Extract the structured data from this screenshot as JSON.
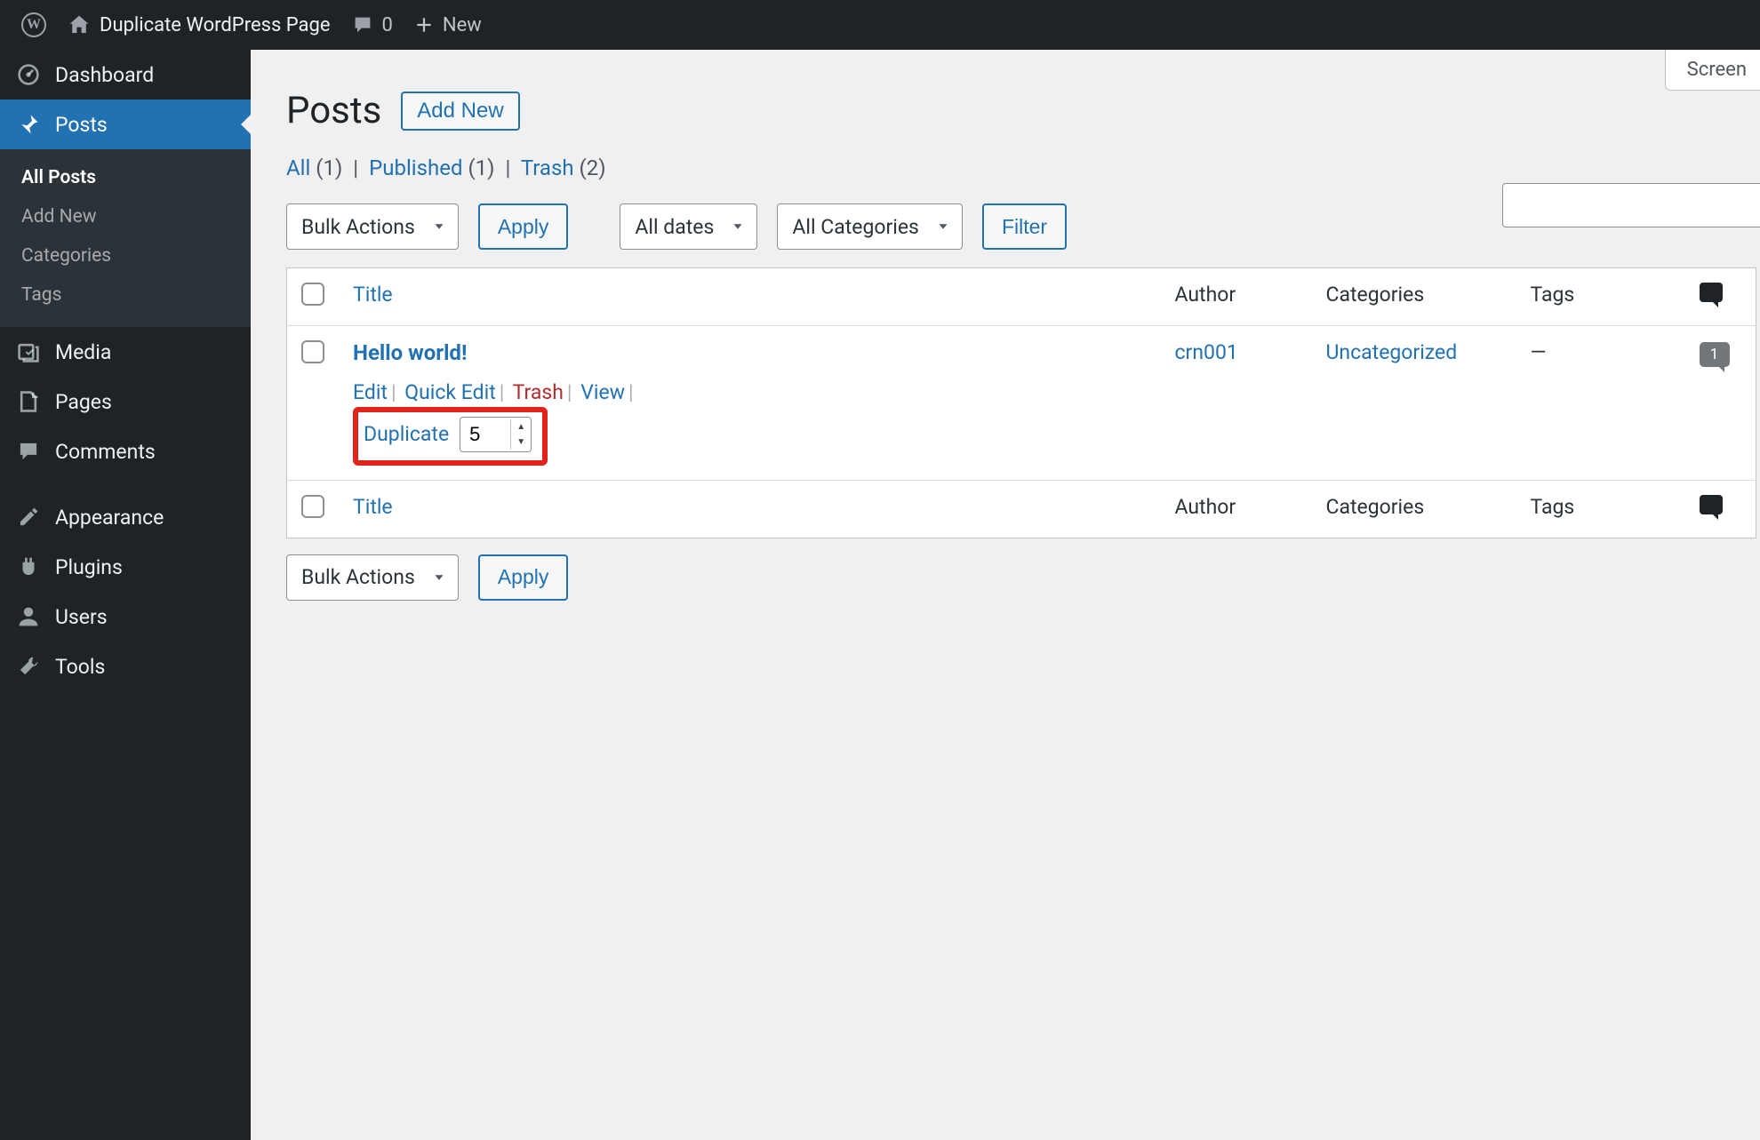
{
  "adminbar": {
    "site_name": "Duplicate WordPress Page",
    "comments_count": "0",
    "new_label": "New"
  },
  "sidebar": {
    "items": [
      {
        "icon": "dashboard-icon",
        "label": "Dashboard"
      },
      {
        "icon": "pin-icon",
        "label": "Posts",
        "current": true
      },
      {
        "icon": "media-icon",
        "label": "Media"
      },
      {
        "icon": "page-icon",
        "label": "Pages"
      },
      {
        "icon": "comment-icon",
        "label": "Comments"
      },
      {
        "icon": "appearance-icon",
        "label": "Appearance"
      },
      {
        "icon": "plugin-icon",
        "label": "Plugins"
      },
      {
        "icon": "user-icon",
        "label": "Users"
      },
      {
        "icon": "tools-icon",
        "label": "Tools"
      }
    ],
    "submenu": [
      {
        "label": "All Posts",
        "current": true
      },
      {
        "label": "Add New"
      },
      {
        "label": "Categories"
      },
      {
        "label": "Tags"
      }
    ]
  },
  "screen_options": "Screen",
  "page_title": "Posts",
  "add_new_btn": "Add New",
  "subsubsub": {
    "all_label": "All",
    "all_count": "(1)",
    "published_label": "Published",
    "published_count": "(1)",
    "trash_label": "Trash",
    "trash_count": "(2)"
  },
  "top_nav": {
    "bulk_actions": "Bulk Actions",
    "apply": "Apply",
    "all_dates": "All dates",
    "all_categories": "All Categories",
    "filter": "Filter"
  },
  "columns": {
    "title": "Title",
    "author": "Author",
    "categories": "Categories",
    "tags": "Tags"
  },
  "rows": [
    {
      "title": "Hello world!",
      "author": "crn001",
      "categories": "Uncategorized",
      "tags": "—",
      "comments": "1",
      "actions": {
        "edit": "Edit",
        "quick_edit": "Quick Edit",
        "trash": "Trash",
        "view": "View",
        "duplicate": "Duplicate",
        "dup_count": "5"
      }
    }
  ],
  "bottom_nav": {
    "bulk_actions": "Bulk Actions",
    "apply": "Apply"
  }
}
